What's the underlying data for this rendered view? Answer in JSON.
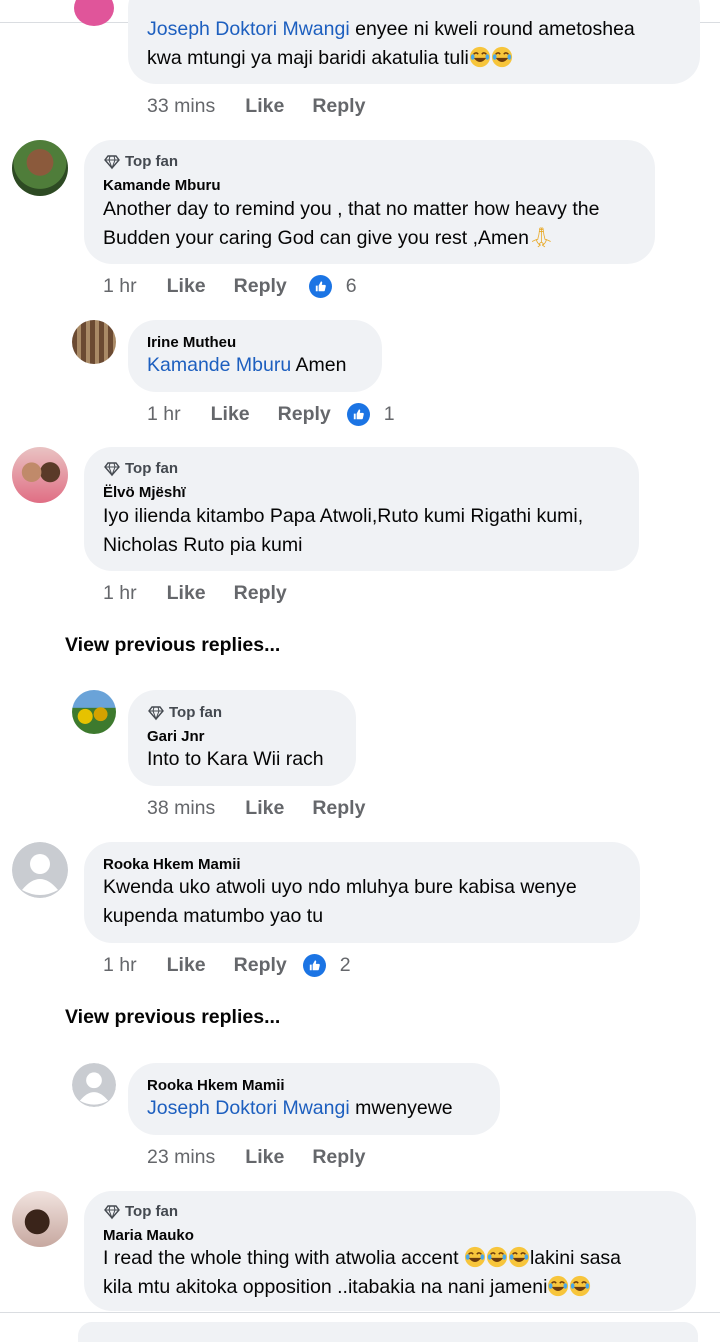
{
  "comments": [
    {
      "text_mention": "Joseph Doktori Mwangi",
      "text_line1": " enyee ni kweli round  ametoshea",
      "text_line2": "kwa mtungi ya maji baridi akatulia tuli",
      "time": "33 mins",
      "like": "Like",
      "reply": "Reply"
    },
    {
      "badge": "Top fan",
      "author": "Kamande Mburu",
      "text_line1": "Another day to remind you , that no matter how heavy the",
      "text_line2": "Budden your caring God can give you rest ,Amen",
      "time": "1 hr",
      "like": "Like",
      "reply": "Reply",
      "reactions": "6"
    },
    {
      "author": "Irine Mutheu",
      "text_mention": "Kamande Mburu",
      "text": " Amen",
      "time": "1 hr",
      "like": "Like",
      "reply": "Reply",
      "reactions": "1"
    },
    {
      "badge": "Top fan",
      "author": "Ëlvö Mjëshï",
      "text_line1": "Iyo ilienda kitambo Papa Atwoli,Ruto kumi Rigathi kumi,",
      "text_line2": "Nicholas Ruto pia kumi",
      "time": "1 hr",
      "like": "Like",
      "reply": "Reply"
    },
    {
      "badge": "Top fan",
      "author": "Gari Jnr",
      "text": "Into to Kara Wii rach",
      "time": "38 mins",
      "like": "Like",
      "reply": "Reply"
    },
    {
      "author": "Rooka Hkem Mamii",
      "text_line1": "Kwenda uko atwoli uyo ndo mluhya  bure kabisa  wenye",
      "text_line2": "kupenda matumbo yao tu",
      "time": "1 hr",
      "like": "Like",
      "reply": "Reply",
      "reactions": "2"
    },
    {
      "author": "Rooka Hkem Mamii",
      "text_mention": "Joseph Doktori Mwangi",
      "text": " mwenyewe",
      "time": "23 mins",
      "like": "Like",
      "reply": "Reply"
    },
    {
      "badge": "Top fan",
      "author": "Maria Mauko",
      "text_line1a": "I read the whole thing with atwolia accent ",
      "text_line1b": "lakini sasa",
      "text_line2": "kila mtu akitoka opposition ..itabakia na nani jameni"
    }
  ],
  "view_previous": "View previous replies...",
  "colors": {
    "bubble": "#f0f2f5",
    "link": "#1d5fbf",
    "meta": "#65676b",
    "like_blue": "#1b74e4"
  },
  "icons": [
    "diamond-icon",
    "like-reaction-icon",
    "laughing-emoji",
    "praying-hands-emoji",
    "default-avatar-icon"
  ]
}
